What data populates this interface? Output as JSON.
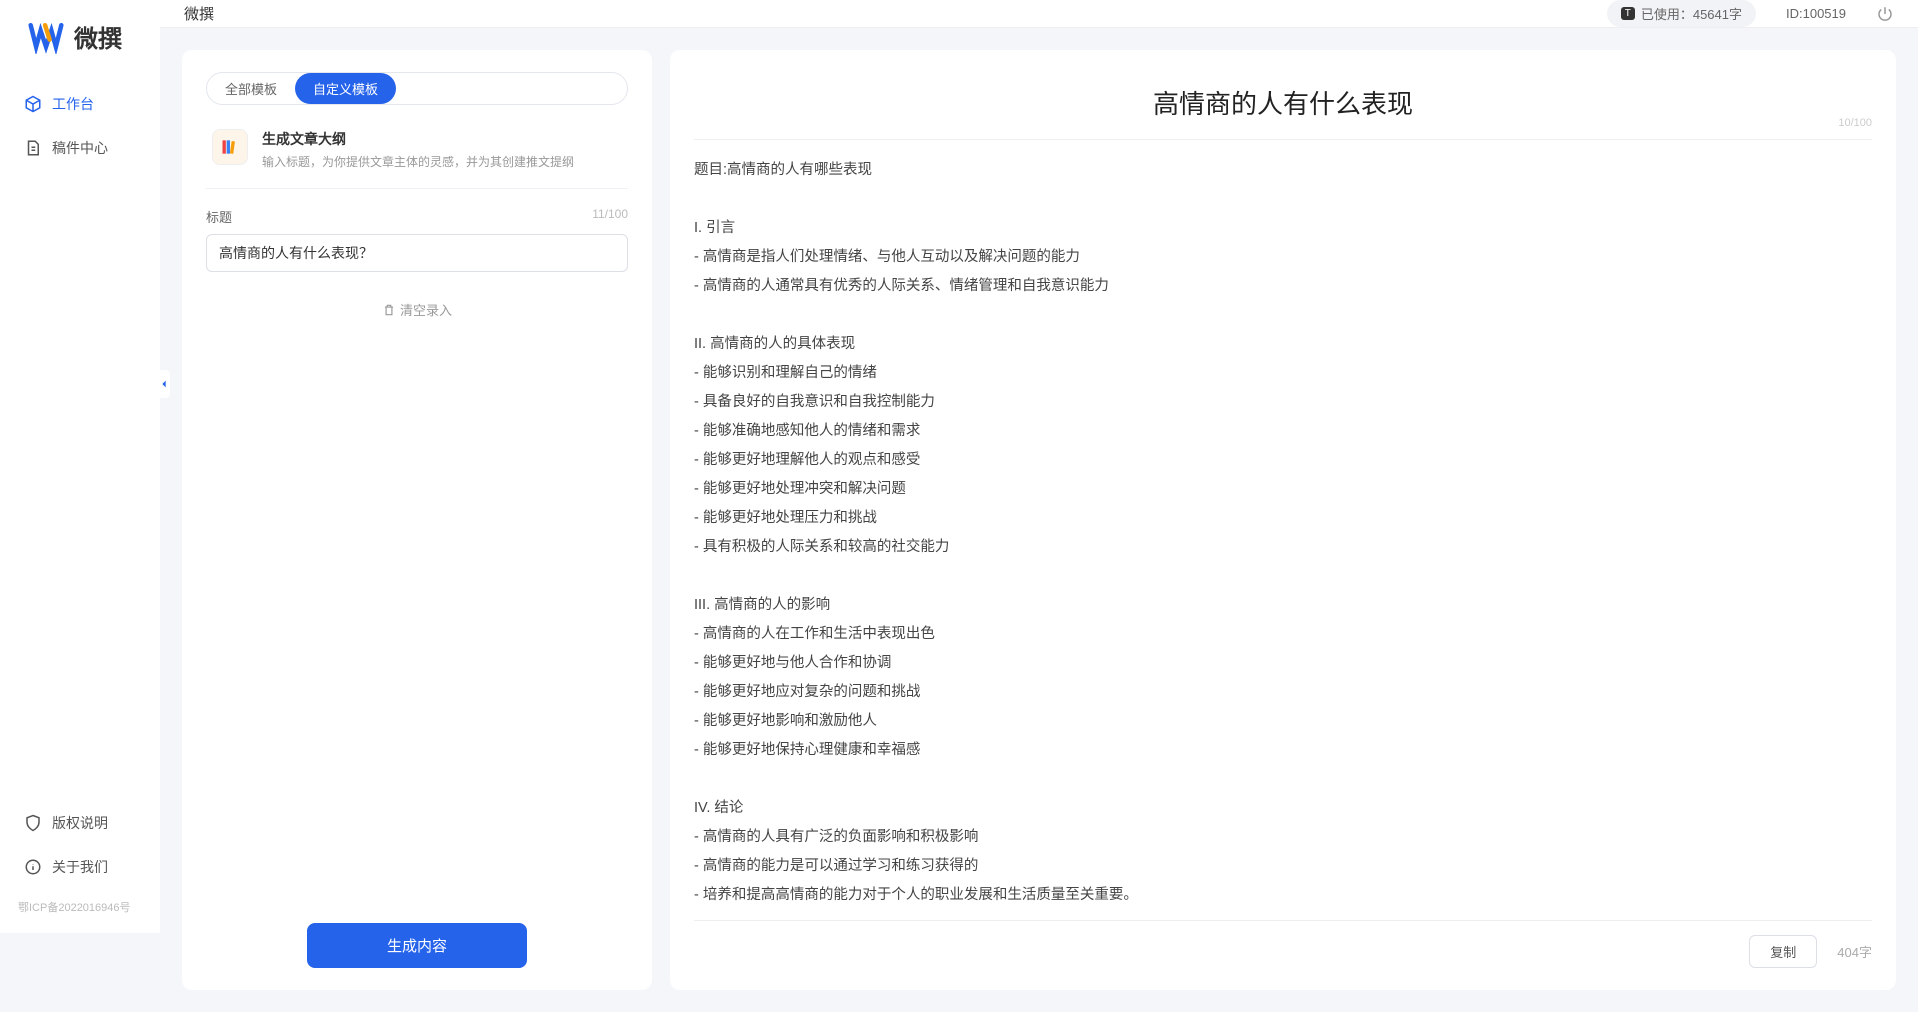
{
  "brand": {
    "name": "微撰"
  },
  "topbar": {
    "title": "微撰",
    "usage_badge": "T",
    "usage_label": "已使用：45641字",
    "user_id": "ID:100519"
  },
  "sidebar": {
    "nav": [
      {
        "label": "工作台",
        "active": true
      },
      {
        "label": "稿件中心",
        "active": false
      }
    ],
    "footer": [
      {
        "label": "版权说明"
      },
      {
        "label": "关于我们"
      }
    ],
    "icp": "鄂ICP备2022016946号"
  },
  "tabs": {
    "all": "全部模板",
    "custom": "自定义模板"
  },
  "template": {
    "title": "生成文章大纲",
    "desc": "输入标题，为你提供文章主体的灵感，并为其创建推文提纲"
  },
  "form": {
    "title_label": "标题",
    "title_counter": "11/100",
    "title_value": "高情商的人有什么表现？",
    "clear_label": "清空录入",
    "generate_label": "生成内容"
  },
  "output": {
    "title": "高情商的人有什么表现",
    "title_counter": "10/100",
    "body": "题目:高情商的人有哪些表现\n\nI. 引言\n- 高情商是指人们处理情绪、与他人互动以及解决问题的能力\n- 高情商的人通常具有优秀的人际关系、情绪管理和自我意识能力\n\nII. 高情商的人的具体表现\n- 能够识别和理解自己的情绪\n- 具备良好的自我意识和自我控制能力\n- 能够准确地感知他人的情绪和需求\n- 能够更好地理解他人的观点和感受\n- 能够更好地处理冲突和解决问题\n- 能够更好地处理压力和挑战\n- 具有积极的人际关系和较高的社交能力\n\nIII. 高情商的人的影响\n- 高情商的人在工作和生活中表现出色\n- 能够更好地与他人合作和协调\n- 能够更好地应对复杂的问题和挑战\n- 能够更好地影响和激励他人\n- 能够更好地保持心理健康和幸福感\n\nIV. 结论\n- 高情商的人具有广泛的负面影响和积极影响\n- 高情商的能力是可以通过学习和练习获得的\n- 培养和提高高情商的能力对于个人的职业发展和生活质量至关重要。",
    "copy_label": "复制",
    "word_count": "404字"
  }
}
